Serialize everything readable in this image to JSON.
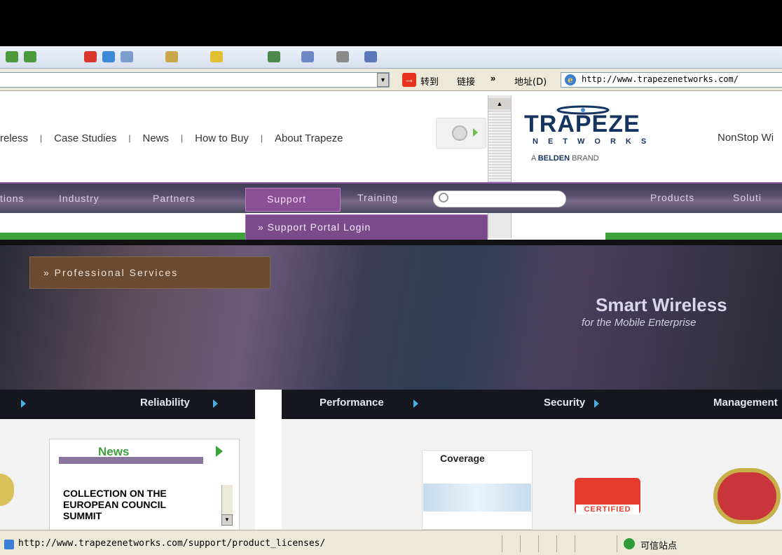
{
  "browser": {
    "go_label": "转到",
    "links_label": "链接",
    "links_chevron": "»",
    "address_label": "地址(D)",
    "address_url": "http://www.trapezenetworks.com/",
    "status_url": "http://www.trapezenetworks.com/support/product_licenses/",
    "status_zone": "可信站点"
  },
  "header": {
    "topnav": [
      "reless",
      "Case Studies",
      "News",
      "How to Buy",
      "About Trapeze"
    ],
    "logo_word": "TRAPEZE",
    "logo_sub": "NETWORKS",
    "logo_brand_prefix": "A ",
    "logo_brand_name": "BELDEN",
    "logo_brand_suffix": " BRAND",
    "tagline": "NonStop Wi"
  },
  "mainnav": {
    "items": [
      "tions",
      "Industry",
      "Partners",
      "Support",
      "Training",
      "Products",
      "Soluti"
    ],
    "dropdown_item": "» Support Portal Login"
  },
  "hero": {
    "professional_services": "» Professional Services",
    "title": "Smart Wireless",
    "subtitle": "for the Mobile Enterprise",
    "links": [
      "",
      "Reliability",
      "Performance",
      "Security",
      "Management"
    ]
  },
  "lower": {
    "news_title": "News",
    "news_headline": "COLLECTION ON THE EUROPEAN COUNCIL SUMMIT",
    "coverage_label": "Coverage",
    "cert_label": "CERTIFIED"
  },
  "colors": {
    "brand_navy": "#14335f",
    "accent_green": "#3ca33a",
    "nav_purple": "#8a4f95"
  }
}
